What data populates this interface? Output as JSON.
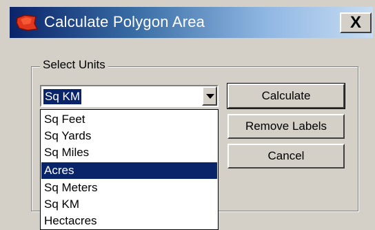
{
  "window": {
    "title": "Calculate Polygon Area",
    "close_label": "X"
  },
  "group": {
    "label": "Select Units"
  },
  "units_combo": {
    "selected": "Sq KM"
  },
  "units_list": {
    "options": [
      "Sq Feet",
      "Sq Yards",
      "Sq Miles",
      "Acres",
      "Sq Meters",
      "Sq KM",
      "Hectacres"
    ],
    "highlighted": "Acres"
  },
  "buttons": {
    "calculate": "Calculate",
    "remove_labels": "Remove Labels",
    "cancel": "Cancel"
  },
  "colors": {
    "titlebar_start": "#0a246a",
    "titlebar_end": "#c7dcf2",
    "selection": "#0a246a",
    "face": "#d4d0c8"
  }
}
